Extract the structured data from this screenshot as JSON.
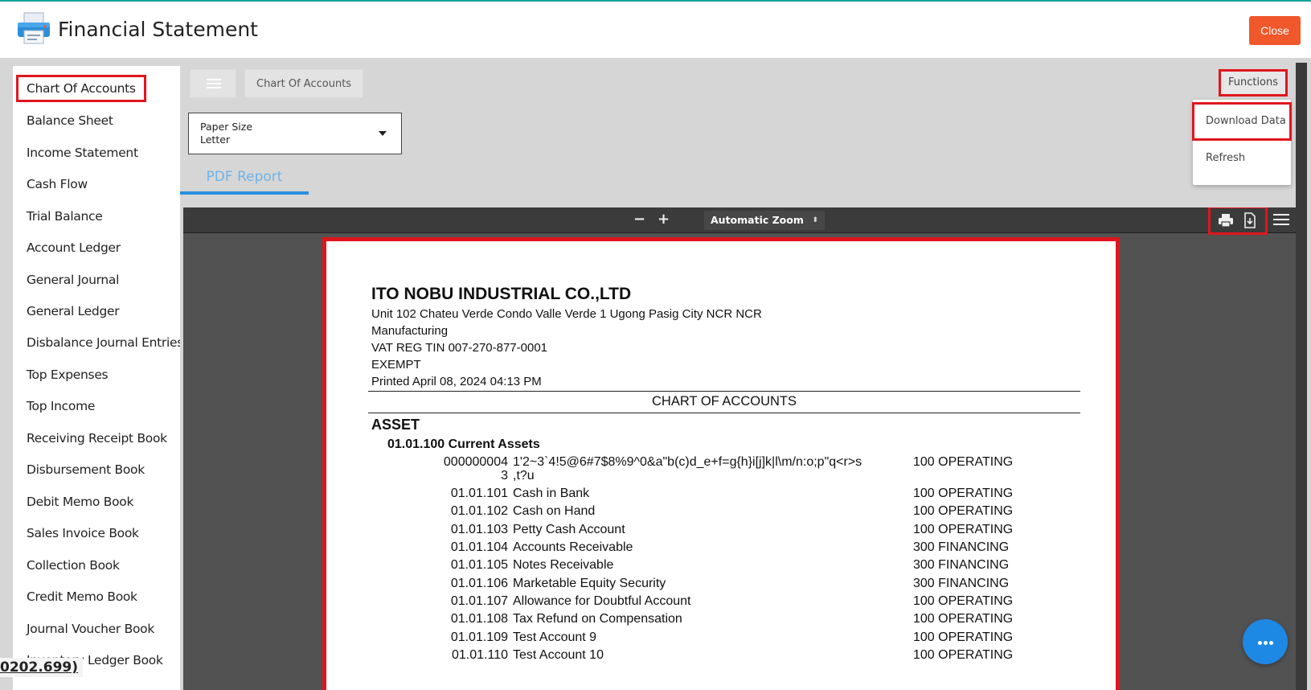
{
  "header": {
    "title": "Financial Statement",
    "close_label": "Close"
  },
  "sidebar": {
    "items": [
      {
        "label": "Chart Of Accounts",
        "active": true
      },
      {
        "label": "Balance Sheet"
      },
      {
        "label": "Income Statement"
      },
      {
        "label": "Cash Flow"
      },
      {
        "label": "Trial Balance"
      },
      {
        "label": "Account Ledger"
      },
      {
        "label": "General Journal"
      },
      {
        "label": "General Ledger"
      },
      {
        "label": "Disbalance Journal Entries"
      },
      {
        "label": "Top Expenses"
      },
      {
        "label": "Top Income"
      },
      {
        "label": "Receiving Receipt Book"
      },
      {
        "label": "Disbursement Book"
      },
      {
        "label": "Debit Memo Book"
      },
      {
        "label": "Sales Invoice Book"
      },
      {
        "label": "Collection Book"
      },
      {
        "label": "Credit Memo Book"
      },
      {
        "label": "Journal Voucher Book"
      },
      {
        "label": "Inventory Ledger Book"
      }
    ]
  },
  "toolbar": {
    "breadcrumb": "Chart Of Accounts",
    "functions_label": "Functions",
    "functions_menu": [
      "Download Data",
      "Refresh"
    ]
  },
  "paper_size": {
    "label": "Paper Size",
    "value": "Letter"
  },
  "tabs": {
    "pdf_report": "PDF Report"
  },
  "viewer": {
    "zoom_out": "−",
    "zoom_in": "+",
    "zoom_value": "Automatic Zoom",
    "zoom_arrows": "⬍"
  },
  "report": {
    "company": "ITO NOBU INDUSTRIAL CO.,LTD",
    "address": "Unit 102 Chateu Verde Condo Valle Verde 1 Ugong  Pasig City NCR NCR",
    "business": "Manufacturing",
    "tin": "VAT REG TIN 007-270-877-0001",
    "tax_status": "EXEMPT",
    "printed": "Printed April 08, 2024 04:13 PM",
    "title": "CHART OF ACCOUNTS",
    "section": "ASSET",
    "group": "01.01.100  Current Assets",
    "accounts": [
      {
        "code": "000000004",
        "code2": "3",
        "name": "1'2~3`4!5@6#7$8%9^0&a\"b(c)d_e+f=g{h}i[j]k|l\\m/n:o;p\"q<r>s",
        "name2": ",t?u",
        "type": "100 OPERATING"
      },
      {
        "code": "01.01.101",
        "name": "Cash in Bank",
        "type": "100 OPERATING"
      },
      {
        "code": "01.01.102",
        "name": "Cash on Hand",
        "type": "100 OPERATING"
      },
      {
        "code": "01.01.103",
        "name": "Petty Cash Account",
        "type": "100 OPERATING"
      },
      {
        "code": "01.01.104",
        "name": "Accounts Receivable",
        "type": "300 FINANCING"
      },
      {
        "code": "01.01.105",
        "name": "Notes Receivable",
        "type": "300 FINANCING"
      },
      {
        "code": "01.01.106",
        "name": "Marketable Equity Security",
        "type": "300 FINANCING"
      },
      {
        "code": "01.01.107",
        "name": "Allowance for Doubtful Account",
        "type": "100 OPERATING"
      },
      {
        "code": "01.01.108",
        "name": "Tax Refund on Compensation",
        "type": "100 OPERATING"
      },
      {
        "code": "01.01.109",
        "name": "Test Account 9",
        "type": "100 OPERATING"
      },
      {
        "code": "01.01.110",
        "name": "Test Account 10",
        "type": "100 OPERATING"
      }
    ]
  },
  "overlay_text": "0202.699)",
  "icons": {
    "app": "printer-app-icon",
    "print": "print-icon",
    "download": "download-icon",
    "menu": "menu-icon",
    "chat": "more-dots-icon"
  },
  "colors": {
    "close_button": "#f0572a",
    "highlight": "#e0161e",
    "tab_active": "#2b8fe0",
    "fab": "#1e88e5"
  }
}
